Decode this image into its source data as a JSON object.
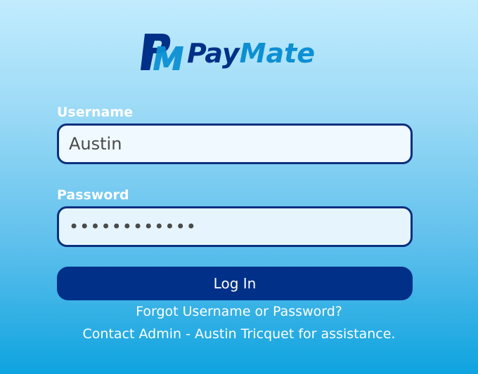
{
  "logo": {
    "word_part1": "Pay",
    "word_part2": "Mate",
    "mark_letters": "PM",
    "colors": {
      "primary": "#003087",
      "accent": "#0d8fd3"
    }
  },
  "form": {
    "username_label": "Username",
    "username_value": "Austin",
    "password_label": "Password",
    "password_value": "••••••••••••",
    "login_label": "Log In"
  },
  "links": {
    "forgot": "Forgot Username or Password?",
    "contact": "Contact Admin - Austin Tricquet for assistance."
  },
  "colors": {
    "button_bg": "#003087",
    "input_border": "#0b2f7e",
    "background_top": "#c2ecfe",
    "background_bottom": "#0ea3df"
  }
}
